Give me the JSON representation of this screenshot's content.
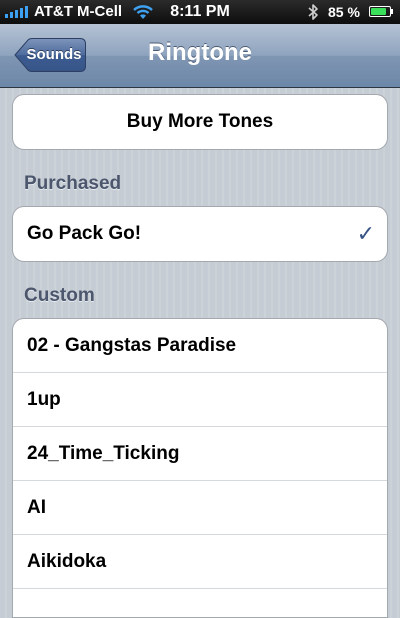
{
  "status_bar": {
    "carrier": "AT&T M-Cell",
    "time": "8:11 PM",
    "battery_percent": "85 %",
    "battery_level": 0.85,
    "icons": [
      "signal-bars-icon",
      "wifi-icon",
      "bluetooth-icon",
      "battery-icon"
    ]
  },
  "nav": {
    "back_label": "Sounds",
    "title": "Ringtone"
  },
  "buy_button": {
    "label": "Buy More Tones"
  },
  "purchased": {
    "header": "Purchased",
    "items": [
      {
        "label": "Go Pack Go!",
        "selected": true
      }
    ],
    "checkmark": "✓"
  },
  "custom": {
    "header": "Custom",
    "items": [
      {
        "label": "02 - Gangstas Paradise"
      },
      {
        "label": "1up"
      },
      {
        "label": "24_Time_Ticking"
      },
      {
        "label": "AI"
      },
      {
        "label": "Aikidoka"
      }
    ]
  },
  "colors": {
    "nav_bar": "#7f96b3",
    "background_stripes": "#c5ccd4",
    "section_header": "#4c566c",
    "checkmark": "#385487",
    "battery_fill": "#3be05a",
    "signal": "#3ea0f0"
  }
}
